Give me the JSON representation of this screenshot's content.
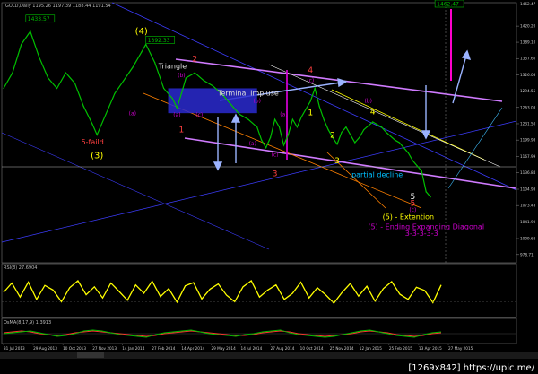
{
  "window": {
    "symbol_line": "GOLD,Daily 1195.26 1197.39 1188.44 1191.54",
    "watermark": "[1269x842] https://upic.me/"
  },
  "chart_data": [
    {
      "type": "line",
      "panel": "price",
      "ylim": [
        968,
        1462
      ],
      "y_ticks": [
        "1462.47",
        "1420.20",
        "1389.10",
        "1357.60",
        "1326.08",
        "1294.55",
        "1263.03",
        "1231.50",
        "1199.98",
        "1167.99",
        "1136.84",
        "1104.93",
        "1073.43",
        "1041.90",
        "1009.62",
        "978.71"
      ],
      "x_ticks": [
        "31 Jul 2013",
        "29 Aug 2013",
        "10 Oct 2013",
        "27 Nov 2013",
        "14 Jan 2014",
        "27 Feb 2014",
        "14 Apr 2014",
        "29 May 2014",
        "14 Jul 2014",
        "27 Aug 2014",
        "10 Oct 2014",
        "25 Nov 2014",
        "12 Jan 2015",
        "25 Feb 2015",
        "13 Apr 2015",
        "27 May 2015"
      ],
      "x_index_range": [
        0,
        100
      ],
      "series": [
        {
          "color": "#00c000",
          "points": [
            [
              0,
              1300
            ],
            [
              2,
              1330
            ],
            [
              4,
              1385
            ],
            [
              6,
              1410
            ],
            [
              8,
              1360
            ],
            [
              10,
              1320
            ],
            [
              12,
              1300
            ],
            [
              14,
              1330
            ],
            [
              16,
              1310
            ],
            [
              18,
              1265
            ],
            [
              20,
              1230
            ],
            [
              21,
              1210
            ],
            [
              23,
              1250
            ],
            [
              25,
              1290
            ],
            [
              27,
              1315
            ],
            [
              29,
              1340
            ],
            [
              31,
              1370
            ],
            [
              32,
              1385
            ],
            [
              34,
              1350
            ],
            [
              36,
              1300
            ],
            [
              38,
              1280
            ],
            [
              39,
              1262
            ],
            [
              40,
              1290
            ],
            [
              41,
              1320
            ],
            [
              43,
              1330
            ],
            [
              45,
              1315
            ],
            [
              47,
              1305
            ],
            [
              49,
              1290
            ],
            [
              51,
              1270
            ],
            [
              53,
              1250
            ],
            [
              55,
              1240
            ],
            [
              57,
              1225
            ],
            [
              58,
              1200
            ],
            [
              59,
              1185
            ],
            [
              60,
              1205
            ],
            [
              61,
              1240
            ],
            [
              62,
              1225
            ],
            [
              63,
              1190
            ],
            [
              64,
              1210
            ],
            [
              65,
              1240
            ],
            [
              66,
              1225
            ],
            [
              67,
              1245
            ],
            [
              69,
              1275
            ],
            [
              70,
              1300
            ],
            [
              71,
              1265
            ],
            [
              72,
              1240
            ],
            [
              73,
              1220
            ],
            [
              74,
              1205
            ],
            [
              75,
              1192
            ],
            [
              76,
              1215
            ],
            [
              77,
              1225
            ],
            [
              78,
              1210
            ],
            [
              79,
              1195
            ],
            [
              80,
              1205
            ],
            [
              81,
              1220
            ],
            [
              83,
              1235
            ],
            [
              85,
              1225
            ],
            [
              86,
              1215
            ],
            [
              88,
              1200
            ],
            [
              89,
              1195
            ],
            [
              90,
              1185
            ],
            [
              91,
              1175
            ],
            [
              92,
              1160
            ],
            [
              93,
              1150
            ],
            [
              94,
              1140
            ],
            [
              95,
              1100
            ],
            [
              96,
              1090
            ]
          ]
        }
      ],
      "highlight_boxes": [
        {
          "color": "#2a2ad0",
          "x_range": [
            37,
            57
          ],
          "y_range": [
            1252,
            1300
          ]
        }
      ],
      "annotations": [
        {
          "text": "1433.57",
          "kind": "price-tag",
          "x": 5,
          "y": 1433
        },
        {
          "text": "1392.33",
          "kind": "price-tag",
          "x": 32,
          "y": 1392
        },
        {
          "text": "1462.47",
          "kind": "price-tag",
          "x": 97,
          "y": 1462
        },
        {
          "text": "(4)",
          "color": "#ffff00",
          "x": 31,
          "y": 1405
        },
        {
          "text": "2",
          "color": "#ff4040",
          "x": 43,
          "y": 1352
        },
        {
          "text": "Triangle",
          "color": "#dddddd",
          "x": 38,
          "y": 1338
        },
        {
          "text": "(b)",
          "color": "#cc00cc",
          "x": 40,
          "y": 1322
        },
        {
          "text": "(a)",
          "color": "#cc00cc",
          "x": 29,
          "y": 1248
        },
        {
          "text": "(b)",
          "color": "#cc00cc",
          "x": 57,
          "y": 1272
        },
        {
          "text": "(a)",
          "color": "#cc00cc",
          "x": 39,
          "y": 1245
        },
        {
          "text": "(c)",
          "color": "#cc00cc",
          "x": 44,
          "y": 1245
        },
        {
          "text": "Terminal Impluse",
          "color": "#dddddd",
          "x": 55,
          "y": 1286
        },
        {
          "text": "(a)",
          "color": "#cc00cc",
          "x": 63,
          "y": 1246
        },
        {
          "text": "(a)",
          "color": "#cc00cc",
          "x": 56,
          "y": 1190
        },
        {
          "text": "(c)",
          "color": "#cc00cc",
          "x": 61,
          "y": 1168
        },
        {
          "text": "4",
          "color": "#ff4040",
          "x": 69,
          "y": 1330
        },
        {
          "text": "(c)",
          "color": "#cc00cc",
          "x": 69,
          "y": 1312
        },
        {
          "text": "(b)",
          "color": "#cc00cc",
          "x": 82,
          "y": 1272
        },
        {
          "text": "1",
          "color": "#ff4040",
          "x": 40,
          "y": 1215
        },
        {
          "text": "3",
          "color": "#ff4040",
          "x": 61,
          "y": 1130
        },
        {
          "text": "1",
          "color": "#ffff00",
          "x": 69,
          "y": 1248
        },
        {
          "text": "2",
          "color": "#ffff00",
          "x": 74,
          "y": 1205
        },
        {
          "text": "3",
          "color": "#ffff00",
          "x": 75,
          "y": 1155
        },
        {
          "text": "4",
          "color": "#ffff00",
          "x": 83,
          "y": 1250
        },
        {
          "text": "5-faild",
          "color": "#ff4040",
          "x": 20,
          "y": 1192
        },
        {
          "text": "(3)",
          "color": "#ffff00",
          "x": 21,
          "y": 1165
        },
        {
          "text": "partial decline",
          "color": "#00bfff",
          "x": 84,
          "y": 1128
        },
        {
          "text": "5",
          "color": "#ffffff",
          "x": 92,
          "y": 1086
        },
        {
          "text": "5",
          "color": "#ff4040",
          "x": 92,
          "y": 1073
        },
        {
          "text": "(c)",
          "color": "#cc00cc",
          "x": 92,
          "y": 1062
        },
        {
          "text": "(5) -  Extention",
          "color": "#ffff00",
          "x": 91,
          "y": 1047
        },
        {
          "text": "(5) - Ending Expanding Diagonal",
          "color": "#cc00cc",
          "x": 95,
          "y": 1028
        },
        {
          "text": "3-3-3-3-3",
          "color": "#cc00cc",
          "x": 94,
          "y": 1015
        }
      ]
    },
    {
      "type": "line",
      "panel": "oscillator",
      "title": "RSI(8) 27.6904",
      "ylim": [
        0,
        100
      ],
      "series": [
        {
          "color": "#ffff00",
          "values": [
            50,
            70,
            40,
            72,
            35,
            65,
            55,
            30,
            60,
            75,
            45,
            62,
            38,
            70,
            52,
            33,
            66,
            48,
            74,
            41,
            58,
            29,
            64,
            71,
            36,
            57,
            68,
            44,
            30,
            62,
            75,
            40,
            55,
            66,
            35,
            48,
            72,
            38,
            60,
            45,
            27,
            50,
            69,
            42,
            63,
            31,
            58,
            73,
            46,
            35,
            61,
            54,
            28,
            66
          ]
        }
      ]
    },
    {
      "type": "line",
      "panel": "macd",
      "title": "OsMA(8,17,9) 1.3913",
      "ylim": [
        -10,
        10
      ],
      "series": [
        {
          "color": "#ff3030",
          "values": [
            1,
            2,
            3,
            2,
            0,
            -1,
            -2,
            -1,
            1,
            2,
            3,
            2,
            1,
            0,
            -1,
            -2,
            -3,
            -2,
            0,
            1,
            2,
            3,
            2,
            1,
            0,
            -1,
            -2,
            -2,
            -1,
            1,
            2,
            3,
            2,
            0,
            -1,
            -2,
            -3,
            -2,
            -1,
            0,
            2,
            3,
            2,
            1,
            -1,
            -2,
            -3,
            -2,
            0,
            1
          ]
        },
        {
          "color": "#00c000",
          "values": [
            0,
            1,
            2,
            3,
            1,
            -1,
            -3,
            -2,
            0,
            3,
            4,
            3,
            1,
            -1,
            -2,
            -3,
            -4,
            -1,
            1,
            2,
            3,
            4,
            2,
            0,
            -1,
            -2,
            -3,
            -1,
            0,
            2,
            3,
            4,
            1,
            -1,
            -2,
            -3,
            -4,
            -3,
            -1,
            1,
            3,
            4,
            2,
            0,
            -2,
            -3,
            -4,
            -1,
            1,
            2
          ]
        }
      ]
    }
  ]
}
